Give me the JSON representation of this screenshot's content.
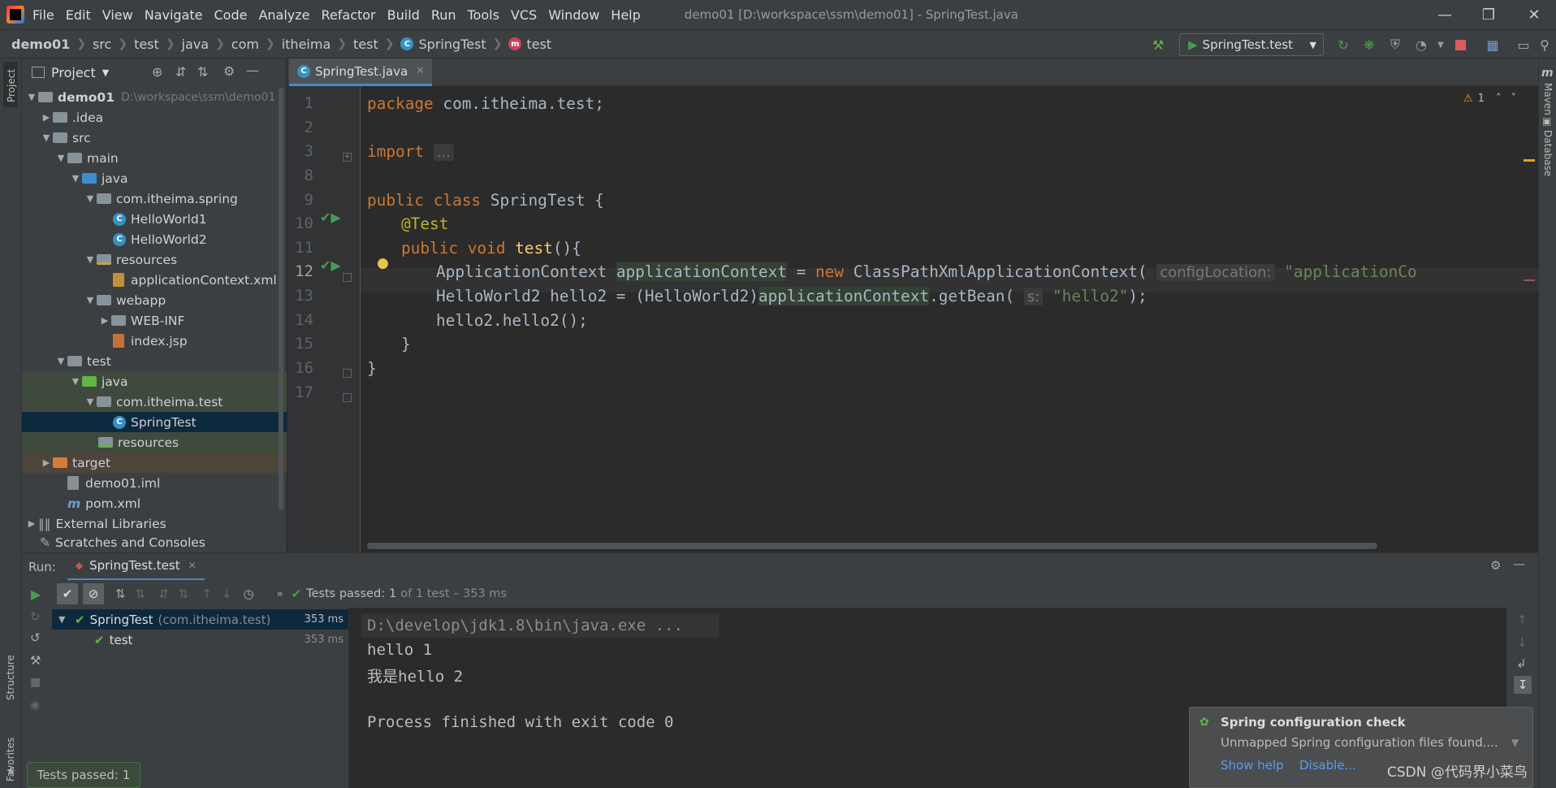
{
  "menu": {
    "items": [
      "File",
      "Edit",
      "View",
      "Navigate",
      "Code",
      "Analyze",
      "Refactor",
      "Build",
      "Run",
      "Tools",
      "VCS",
      "Window",
      "Help"
    ],
    "window_title": "demo01 [D:\\workspace\\ssm\\demo01] - SpringTest.java"
  },
  "breadcrumb": [
    "demo01",
    "src",
    "test",
    "java",
    "com",
    "itheima",
    "test",
    "SpringTest",
    "test"
  ],
  "run_config": "SpringTest.test",
  "project": {
    "header": "Project",
    "tree": [
      {
        "label": "demo01",
        "path": "D:\\workspace\\ssm\\demo01"
      },
      {
        "label": ".idea"
      },
      {
        "label": "src"
      },
      {
        "label": "main"
      },
      {
        "label": "java"
      },
      {
        "label": "com.itheima.spring"
      },
      {
        "label": "HelloWorld1"
      },
      {
        "label": "HelloWorld2"
      },
      {
        "label": "resources"
      },
      {
        "label": "applicationContext.xml"
      },
      {
        "label": "webapp"
      },
      {
        "label": "WEB-INF"
      },
      {
        "label": "index.jsp"
      },
      {
        "label": "test"
      },
      {
        "label": "java"
      },
      {
        "label": "com.itheima.test"
      },
      {
        "label": "SpringTest"
      },
      {
        "label": "resources"
      },
      {
        "label": "target"
      },
      {
        "label": "demo01.iml"
      },
      {
        "label": "pom.xml"
      },
      {
        "label": "External Libraries"
      },
      {
        "label": "Scratches and Consoles"
      }
    ]
  },
  "editor": {
    "tab": "SpringTest.java",
    "warning_count": "1",
    "line_numbers": [
      "1",
      "2",
      "3",
      "8",
      "9",
      "10",
      "11",
      "12",
      "13",
      "14",
      "15",
      "16",
      "17"
    ],
    "code": {
      "l1_kw": "package",
      "l1_rest": " com.itheima.test;",
      "l3_import": "import",
      "l3_fold": "...",
      "l9_kw": "public class",
      "l9_rest": " SpringTest {",
      "l10_ann": "@Test",
      "l11_kw": "public void",
      "l11_fn": "test",
      "l11_rest": "(){",
      "l12_a": "ApplicationContext ",
      "l12_var": "applicationContext",
      "l12_b": " = ",
      "l12_kw": "new",
      "l12_c": " ClassPathXmlApplicationContext(",
      "l12_hint": "configLocation:",
      "l12_str": "\"applicationCo",
      "l13_a": "HelloWorld2 hello2 = (HelloWorld2)",
      "l13_var": "applicationContext",
      "l13_b": ".getBean(",
      "l13_hint": "s:",
      "l13_str": "\"hello2\"",
      "l13_c": ");",
      "l14": "hello2.hello2();",
      "l15": "}",
      "l16": "}"
    }
  },
  "side_labels": {
    "left_top": "Project",
    "left_structure": "Structure",
    "left_favorites": "Favorites",
    "right_maven": "Maven",
    "right_database": "Database"
  },
  "run": {
    "label": "Run:",
    "tab": "SpringTest.test",
    "status_prefix": "Tests passed:",
    "status_count": "1",
    "status_suffix": "of 1 test – 353 ms",
    "tree": [
      {
        "name": "SpringTest",
        "detail": "(com.itheima.test)",
        "time": "353 ms"
      },
      {
        "name": "test",
        "detail": "",
        "time": "353 ms"
      }
    ],
    "console": [
      "D:\\develop\\jdk1.8\\bin\\java.exe ...",
      "hello 1",
      "我是hello 2",
      "",
      "Process finished with exit code 0"
    ]
  },
  "notification": {
    "title": "Spring configuration check",
    "body": "Unmapped Spring configuration files found....",
    "action_help": "Show help",
    "action_disable": "Disable..."
  },
  "status_tooltip": "Tests passed: 1",
  "watermark": "CSDN @代码界小菜鸟",
  "colors": {
    "keyword": "#cc7832",
    "annotation": "#bbb529",
    "string": "#6a8759",
    "function": "#ffc66d",
    "success": "#499c54",
    "accent": "#4a88c7"
  }
}
